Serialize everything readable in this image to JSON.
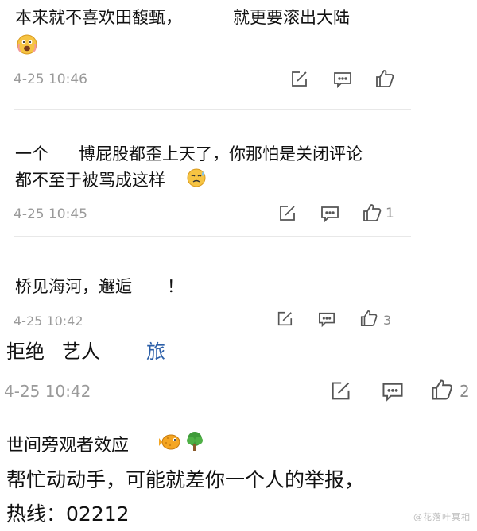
{
  "comments": [
    {
      "line1": "本来就不喜欢田馥甄，",
      "line1b": "就更要滚出大陆",
      "emoji": "scared-face-emoji",
      "timestamp": "4-25 10:46",
      "likes": ""
    },
    {
      "line1a": "一个",
      "line1b": "博屁股都歪上天了，你那怕是关闭评论",
      "line2": "都不至于被骂成这样",
      "emoji": "sweat-face-emoji",
      "timestamp": "4-25 10:45",
      "likes": "1"
    },
    {
      "line1a": "桥见海河，邂逅",
      "line1b": "！",
      "timestamp": "4-25 10:42",
      "likes": "3"
    },
    {
      "line1a": "拒绝",
      "line1b": "艺人",
      "line1c": "旅",
      "timestamp": "4-25 10:42",
      "likes": "2"
    },
    {
      "line1": "世间旁观者效应",
      "line2": "帮忙动动手，可能就差你一个人的举报，",
      "line3a": "热线：",
      "line3b": "02212"
    }
  ],
  "watermark": "@花落叶冥相"
}
